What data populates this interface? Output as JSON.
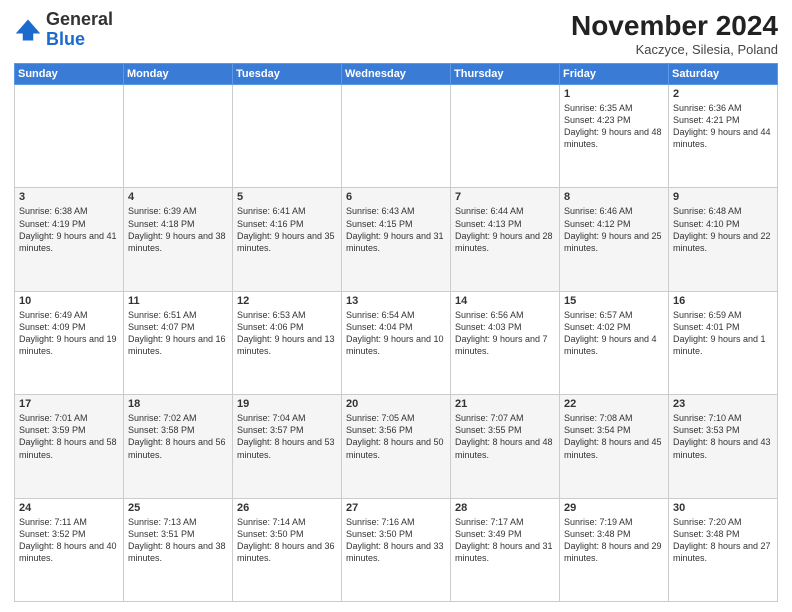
{
  "logo": {
    "general": "General",
    "blue": "Blue"
  },
  "title": "November 2024",
  "subtitle": "Kaczyce, Silesia, Poland",
  "days_of_week": [
    "Sunday",
    "Monday",
    "Tuesday",
    "Wednesday",
    "Thursday",
    "Friday",
    "Saturday"
  ],
  "weeks": [
    [
      {
        "day": "",
        "info": ""
      },
      {
        "day": "",
        "info": ""
      },
      {
        "day": "",
        "info": ""
      },
      {
        "day": "",
        "info": ""
      },
      {
        "day": "",
        "info": ""
      },
      {
        "day": "1",
        "info": "Sunrise: 6:35 AM\nSunset: 4:23 PM\nDaylight: 9 hours and 48 minutes."
      },
      {
        "day": "2",
        "info": "Sunrise: 6:36 AM\nSunset: 4:21 PM\nDaylight: 9 hours and 44 minutes."
      }
    ],
    [
      {
        "day": "3",
        "info": "Sunrise: 6:38 AM\nSunset: 4:19 PM\nDaylight: 9 hours and 41 minutes."
      },
      {
        "day": "4",
        "info": "Sunrise: 6:39 AM\nSunset: 4:18 PM\nDaylight: 9 hours and 38 minutes."
      },
      {
        "day": "5",
        "info": "Sunrise: 6:41 AM\nSunset: 4:16 PM\nDaylight: 9 hours and 35 minutes."
      },
      {
        "day": "6",
        "info": "Sunrise: 6:43 AM\nSunset: 4:15 PM\nDaylight: 9 hours and 31 minutes."
      },
      {
        "day": "7",
        "info": "Sunrise: 6:44 AM\nSunset: 4:13 PM\nDaylight: 9 hours and 28 minutes."
      },
      {
        "day": "8",
        "info": "Sunrise: 6:46 AM\nSunset: 4:12 PM\nDaylight: 9 hours and 25 minutes."
      },
      {
        "day": "9",
        "info": "Sunrise: 6:48 AM\nSunset: 4:10 PM\nDaylight: 9 hours and 22 minutes."
      }
    ],
    [
      {
        "day": "10",
        "info": "Sunrise: 6:49 AM\nSunset: 4:09 PM\nDaylight: 9 hours and 19 minutes."
      },
      {
        "day": "11",
        "info": "Sunrise: 6:51 AM\nSunset: 4:07 PM\nDaylight: 9 hours and 16 minutes."
      },
      {
        "day": "12",
        "info": "Sunrise: 6:53 AM\nSunset: 4:06 PM\nDaylight: 9 hours and 13 minutes."
      },
      {
        "day": "13",
        "info": "Sunrise: 6:54 AM\nSunset: 4:04 PM\nDaylight: 9 hours and 10 minutes."
      },
      {
        "day": "14",
        "info": "Sunrise: 6:56 AM\nSunset: 4:03 PM\nDaylight: 9 hours and 7 minutes."
      },
      {
        "day": "15",
        "info": "Sunrise: 6:57 AM\nSunset: 4:02 PM\nDaylight: 9 hours and 4 minutes."
      },
      {
        "day": "16",
        "info": "Sunrise: 6:59 AM\nSunset: 4:01 PM\nDaylight: 9 hours and 1 minute."
      }
    ],
    [
      {
        "day": "17",
        "info": "Sunrise: 7:01 AM\nSunset: 3:59 PM\nDaylight: 8 hours and 58 minutes."
      },
      {
        "day": "18",
        "info": "Sunrise: 7:02 AM\nSunset: 3:58 PM\nDaylight: 8 hours and 56 minutes."
      },
      {
        "day": "19",
        "info": "Sunrise: 7:04 AM\nSunset: 3:57 PM\nDaylight: 8 hours and 53 minutes."
      },
      {
        "day": "20",
        "info": "Sunrise: 7:05 AM\nSunset: 3:56 PM\nDaylight: 8 hours and 50 minutes."
      },
      {
        "day": "21",
        "info": "Sunrise: 7:07 AM\nSunset: 3:55 PM\nDaylight: 8 hours and 48 minutes."
      },
      {
        "day": "22",
        "info": "Sunrise: 7:08 AM\nSunset: 3:54 PM\nDaylight: 8 hours and 45 minutes."
      },
      {
        "day": "23",
        "info": "Sunrise: 7:10 AM\nSunset: 3:53 PM\nDaylight: 8 hours and 43 minutes."
      }
    ],
    [
      {
        "day": "24",
        "info": "Sunrise: 7:11 AM\nSunset: 3:52 PM\nDaylight: 8 hours and 40 minutes."
      },
      {
        "day": "25",
        "info": "Sunrise: 7:13 AM\nSunset: 3:51 PM\nDaylight: 8 hours and 38 minutes."
      },
      {
        "day": "26",
        "info": "Sunrise: 7:14 AM\nSunset: 3:50 PM\nDaylight: 8 hours and 36 minutes."
      },
      {
        "day": "27",
        "info": "Sunrise: 7:16 AM\nSunset: 3:50 PM\nDaylight: 8 hours and 33 minutes."
      },
      {
        "day": "28",
        "info": "Sunrise: 7:17 AM\nSunset: 3:49 PM\nDaylight: 8 hours and 31 minutes."
      },
      {
        "day": "29",
        "info": "Sunrise: 7:19 AM\nSunset: 3:48 PM\nDaylight: 8 hours and 29 minutes."
      },
      {
        "day": "30",
        "info": "Sunrise: 7:20 AM\nSunset: 3:48 PM\nDaylight: 8 hours and 27 minutes."
      }
    ]
  ]
}
